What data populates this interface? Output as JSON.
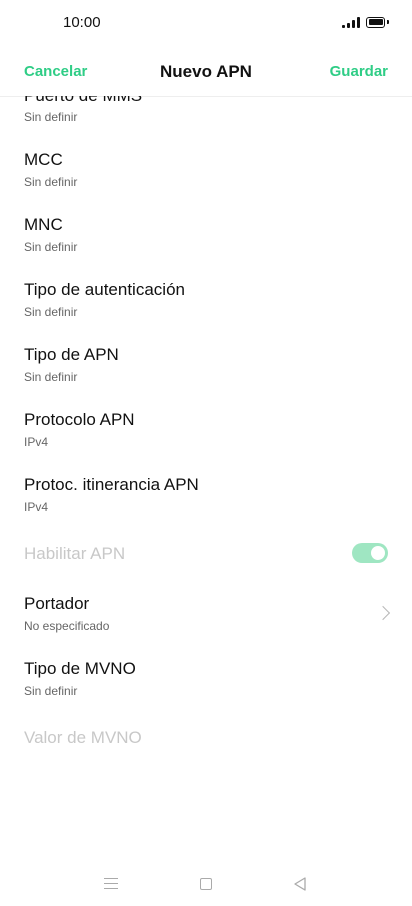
{
  "status": {
    "time": "10:00"
  },
  "header": {
    "cancel": "Cancelar",
    "title": "Nuevo APN",
    "save": "Guardar"
  },
  "fields": [
    {
      "label": "Puerto de MMS",
      "value": "Sin definir"
    },
    {
      "label": "MCC",
      "value": "Sin definir"
    },
    {
      "label": "MNC",
      "value": "Sin definir"
    },
    {
      "label": "Tipo de autenticación",
      "value": "Sin definir"
    },
    {
      "label": "Tipo de APN",
      "value": "Sin definir"
    },
    {
      "label": "Protocolo APN",
      "value": "IPv4"
    },
    {
      "label": "Protoc. itinerancia APN",
      "value": "IPv4"
    },
    {
      "label": "Habilitar APN",
      "enabled": false,
      "toggle_on": true
    },
    {
      "label": "Portador",
      "value": "No especificado"
    },
    {
      "label": "Tipo de MVNO",
      "value": "Sin definir"
    },
    {
      "label": "Valor de MVNO",
      "enabled": false
    }
  ],
  "colors": {
    "accent": "#2fcd86",
    "toggle_track": "#9fe6c2",
    "disabled_text": "#c8c8c8"
  },
  "icons": {
    "nav": [
      "menu-icon",
      "home-icon",
      "back-icon"
    ],
    "row_chevron": "chevron-right-icon"
  }
}
